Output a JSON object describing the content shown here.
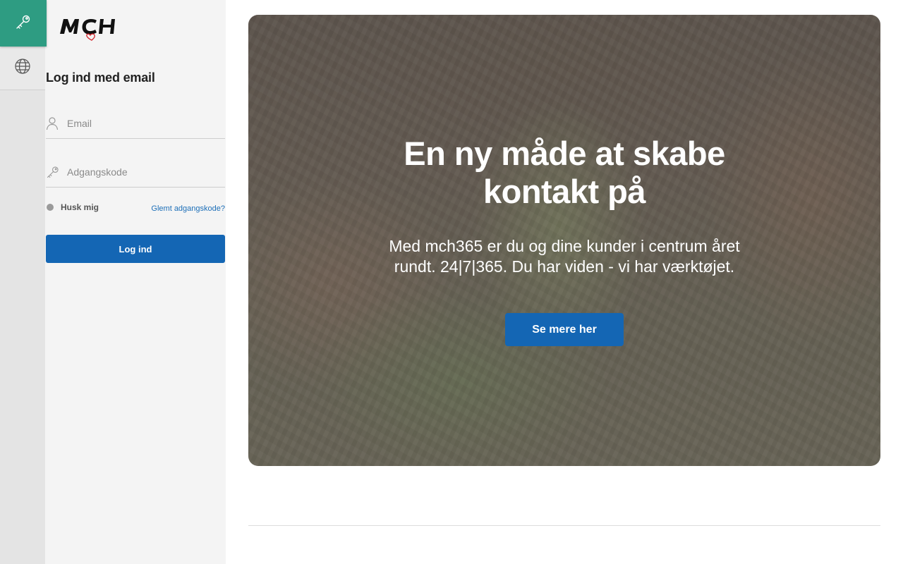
{
  "rail": {
    "login_icon": "key-icon",
    "language_icon": "globe-icon"
  },
  "brand": {
    "logo_text": "MCH"
  },
  "login": {
    "heading": "Log ind med email",
    "email_placeholder": "Email",
    "password_placeholder": "Adgangskode",
    "remember_label": "Husk mig",
    "forgot_label": "Glemt adgangskode?",
    "submit_label": "Log ind"
  },
  "hero": {
    "title_line1": "En ny måde at skabe",
    "title_line2": "kontakt på",
    "text": "Med mch365 er du og dine kunder i centrum året rundt. 24|7|365. Du har viden - vi har værktøjet.",
    "button_label": "Se mere her"
  },
  "colors": {
    "accent_green": "#2e9c82",
    "primary_blue": "#1466b4"
  }
}
